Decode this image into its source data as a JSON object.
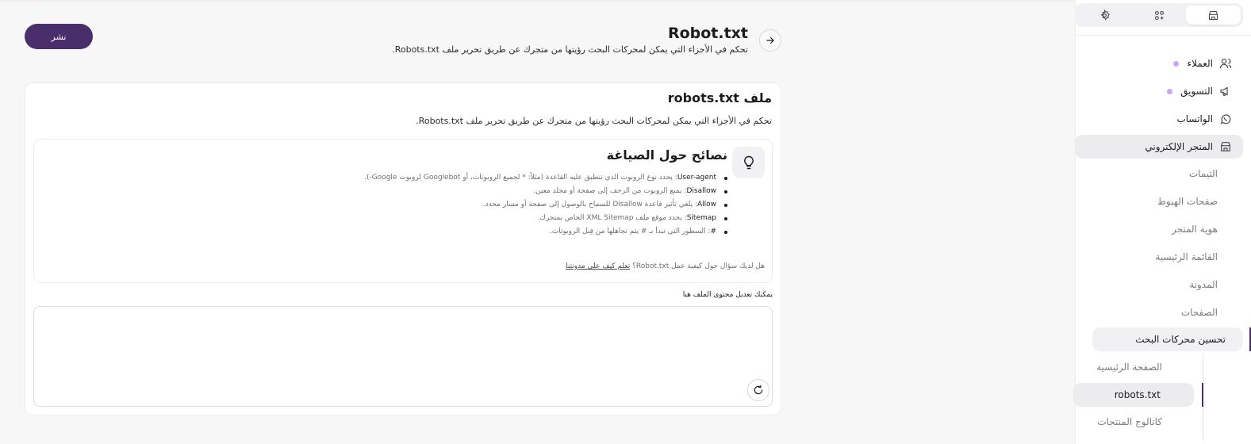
{
  "header": {
    "title": "Robot.txt",
    "description": "تحكم في الأجزاء التي يمكن لمحركات البحث رؤيتها من متجرك عن طريق تحرير ملف Robots.txt.",
    "publish_label": "نشر",
    "back_icon": "arrow-right-icon"
  },
  "card": {
    "title": "ملف robots.txt",
    "description": "تحكم في الأجزاء التي يمكن لمحركات البحث رؤيتها من متجرك عن طريق تحرير ملف Robots.txt.",
    "tips": {
      "title": "نصائح حول الصياغة",
      "icon": "lightbulb-icon",
      "items": [
        {
          "key": "User-agent",
          "text": ": يحدد نوع الروبوت الذي تنطبق عليه القاعدة (مثلاً: * لجميع الروبوتات، أو Googlebot لروبوت Google-)."
        },
        {
          "key": "Disallow",
          "text": ": يمنع الروبوت من الزحف إلى صفحة أو مجلد معين."
        },
        {
          "key": "Allow",
          "text": ": يلغي تأثير قاعدة Disallow للسماح بالوصول إلى صفحة أو مسار محدد."
        },
        {
          "key": "Sitemap",
          "text": ": يحدد موقع ملف XML Sitemap الخاص بمتجرك."
        },
        {
          "key": "#",
          "text": ": السطور التي تبدأ بـ # يتم تجاهلها من قِبل الروبوتات."
        }
      ],
      "help_text": "هل لديك سؤال حول كيفية عمل Robot.txt؟ ",
      "help_link": "تعلم كيف على مدونتنا"
    },
    "editor": {
      "label": "يمكنك تعديل محتوى الملف هنا",
      "value": "",
      "reset_icon": "refresh-icon"
    }
  },
  "sidebar": {
    "top_tabs": [
      {
        "icon": "store-icon",
        "active": true
      },
      {
        "icon": "apps-icon",
        "active": false
      },
      {
        "icon": "settings-icon",
        "active": false
      }
    ],
    "nav": [
      {
        "label": "العملاء",
        "icon": "users-icon",
        "dot": "#c9a7f0"
      },
      {
        "label": "التسويق",
        "icon": "megaphone-icon",
        "dot": "#c9a7f0"
      },
      {
        "label": "الواتساب",
        "icon": "whatsapp-icon"
      },
      {
        "label": "المتجر الإلكتروني",
        "icon": "store-icon",
        "active": true
      }
    ],
    "sub": [
      "الثيمات",
      "صفحات الهبوط",
      "هوية المتجر",
      "القائمة الرئيسية",
      "المدونة",
      "الصفحات",
      "تحسين محركات البحث"
    ],
    "seo_sub": [
      "الصفحة الرئيسية",
      "robots.txt",
      "كاتالوج المنتجات"
    ]
  },
  "colors": {
    "brand": "#4a2d6b",
    "dot": "#c9a7f0"
  }
}
